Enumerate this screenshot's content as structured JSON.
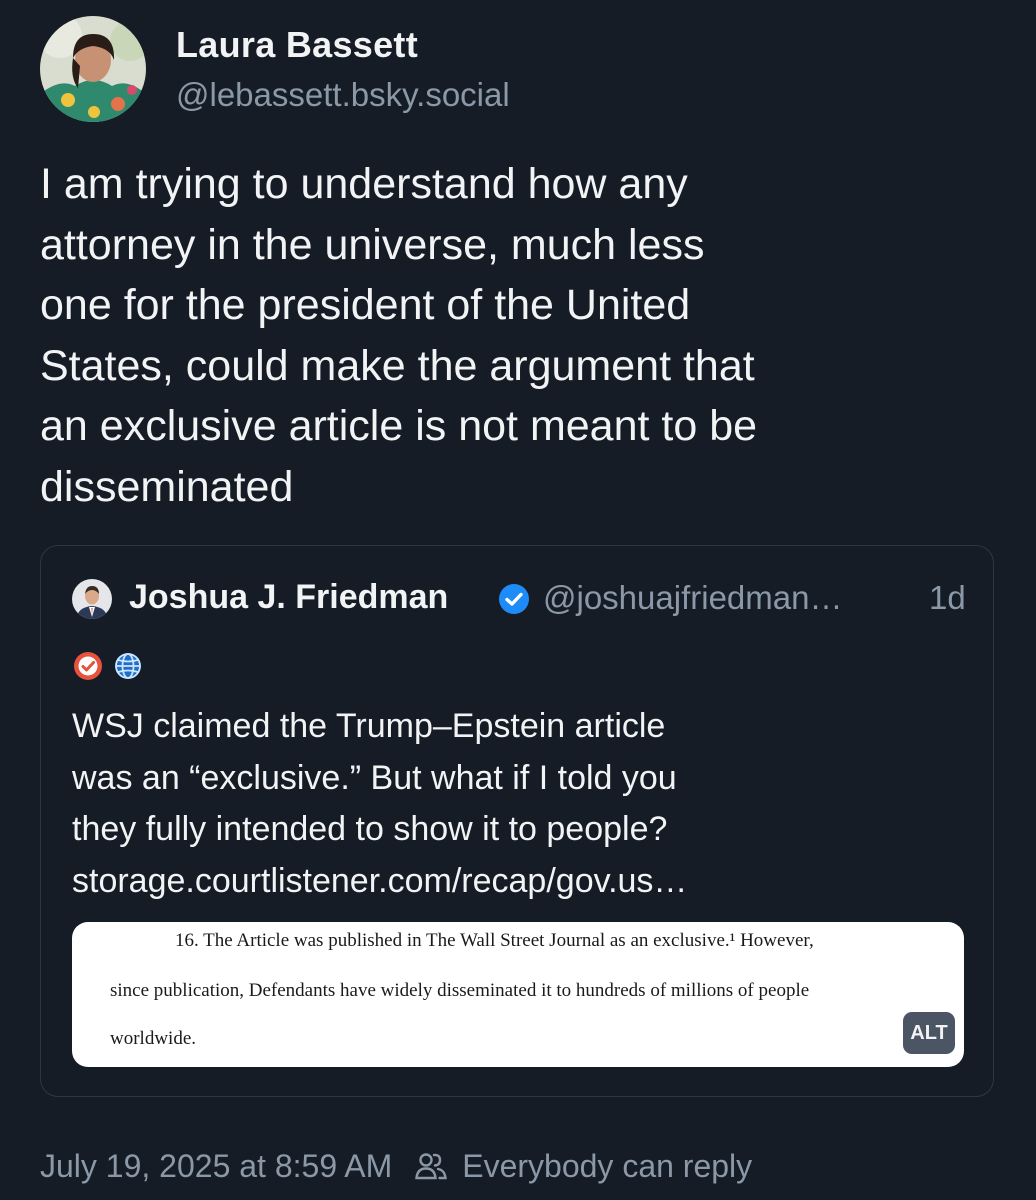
{
  "author": {
    "display_name": "Laura Bassett",
    "handle": "@lebassett.bsky.social",
    "avatar_icon": "avatar"
  },
  "post": {
    "text": "I am trying to understand how any\nattorney in the universe, much less\none for the president of the United\nStates, could make the argument that\nan exclusive article is not meant to be\ndisseminated",
    "timestamp": "July 19, 2025 at 8:59 AM",
    "reply_setting": "Everybody can reply"
  },
  "quote": {
    "display_name": "Joshua J. Friedman",
    "handle": "@joshuajfriedman…",
    "time_ago": "1d",
    "verified": true,
    "badges": [
      "checkmark-badge-icon",
      "globe-icon"
    ],
    "text": "WSJ claimed the Trump–Epstein article\nwas an “exclusive.” But what if I told you\nthey fully intended to show it to people?\nstorage.courtlistener.com/recap/gov.us…",
    "image": {
      "line1": "16.      The Article was published in The Wall Street Journal as an exclusive.¹ However,",
      "line2": "since publication, Defendants have widely disseminated it to hundreds of millions of people",
      "line3": "worldwide.",
      "alt_label": "ALT"
    }
  },
  "colors": {
    "background": "#151c25",
    "text": "#f1f3f5",
    "muted": "#8b98a8",
    "border": "#2c3746",
    "verified_blue": "#1d8cf8",
    "badge_red": "#e5533d"
  }
}
